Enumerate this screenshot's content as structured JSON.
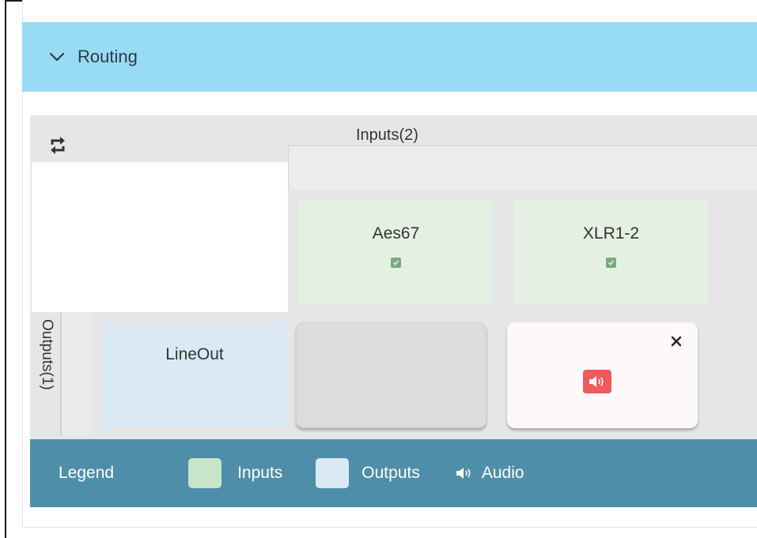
{
  "header": {
    "title": "Routing",
    "toggle_icon": "chevron-down-icon"
  },
  "grid": {
    "inputs_label": "Inputs(2)",
    "outputs_label": "Outputs(1)",
    "inputs": [
      {
        "name": "Aes67",
        "checked": true
      },
      {
        "name": "XLR1-2",
        "checked": true
      }
    ],
    "outputs": [
      {
        "name": "LineOut"
      }
    ],
    "routes": [
      {
        "input": "Aes67",
        "output": "LineOut",
        "active": false
      },
      {
        "input": "XLR1-2",
        "output": "LineOut",
        "active": true,
        "signal": "audio-icon"
      }
    ]
  },
  "legend": {
    "title": "Legend",
    "inputs_label": "Inputs",
    "outputs_label": "Outputs",
    "audio_label": "Audio"
  },
  "colors": {
    "header_bg": "#97dbf4",
    "input_cell": "#e4f1e2",
    "output_cell": "#dae9f4",
    "legend_bg": "#4f8ea9",
    "audio_badge": "#ef5a5d"
  }
}
